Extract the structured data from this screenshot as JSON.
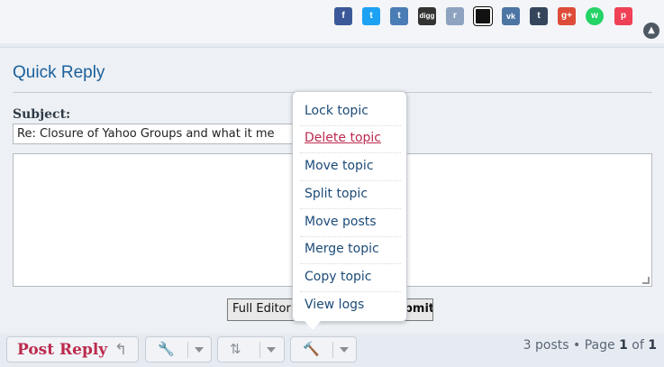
{
  "share": {
    "icons": [
      {
        "name": "facebook-icon",
        "glyph": "f",
        "color": "#3b5998"
      },
      {
        "name": "twitter-icon",
        "glyph": "t",
        "color": "#1da1f2"
      },
      {
        "name": "tumblr-icon",
        "glyph": "t",
        "color": "#4a7db5"
      },
      {
        "name": "digg-icon",
        "glyph": "digg",
        "color": "#333333"
      },
      {
        "name": "reddit-icon",
        "glyph": "r",
        "color": "#8da3c0"
      },
      {
        "name": "delicious-icon",
        "glyph": "",
        "color": "#111111"
      },
      {
        "name": "vk-icon",
        "glyph": "vk",
        "color": "#4c75a3"
      },
      {
        "name": "tumblr-t-icon",
        "glyph": "t",
        "color": "#35465c"
      },
      {
        "name": "google-plus-icon",
        "glyph": "g+",
        "color": "#dd4b39"
      },
      {
        "name": "whatsapp-icon",
        "glyph": "w",
        "color": "#25d366"
      },
      {
        "name": "pocket-icon",
        "glyph": "p",
        "color": "#ef4056"
      }
    ]
  },
  "quick_reply": {
    "title": "Quick Reply",
    "subject_label": "Subject:",
    "subject_value": "Re: Closure of Yahoo Groups and what it me",
    "message_value": "",
    "full_editor_label": "Full Editor",
    "submit_label": "Submit"
  },
  "moderation_menu": {
    "items": [
      {
        "label": "Lock topic",
        "danger": false
      },
      {
        "label": "Delete topic",
        "danger": true
      },
      {
        "label": "Move topic",
        "danger": false
      },
      {
        "label": "Split topic",
        "danger": false
      },
      {
        "label": "Move posts",
        "danger": false
      },
      {
        "label": "Merge topic",
        "danger": false
      },
      {
        "label": "Copy topic",
        "danger": false
      },
      {
        "label": "View logs",
        "danger": false
      }
    ]
  },
  "actions": {
    "post_reply_label": "Post Reply",
    "post_reply_icon": "reply-icon",
    "tools_icon": "wrench-icon",
    "sort_icon": "sort-icon",
    "moderation_icon": "gavel-icon"
  },
  "pagination": {
    "posts_count": "3 posts",
    "page_word": "Page",
    "current_page": "1",
    "of_word": "of",
    "total_pages": "1"
  },
  "colors": {
    "link": "#1c4b78",
    "danger": "#bc2a4d",
    "title": "#1b5f9a"
  }
}
